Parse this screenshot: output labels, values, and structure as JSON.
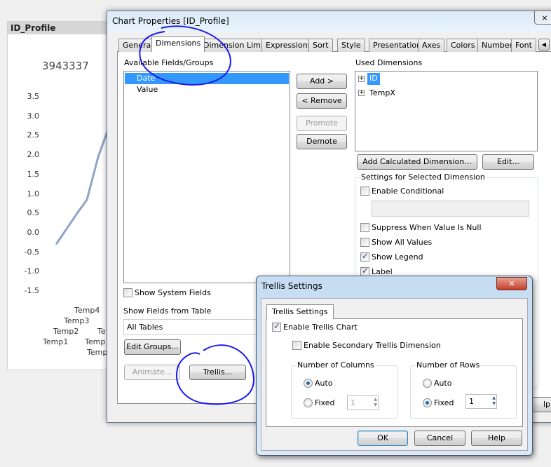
{
  "chart_panel": {
    "title": "ID_Profile",
    "value": "3943337",
    "chart_data": {
      "type": "line",
      "y_ticks": [
        "3.5",
        "3.0",
        "2.5",
        "2.0",
        "1.5",
        "1.0",
        "0.5",
        "0.0",
        "-0.5",
        "-1.0",
        "-1.5"
      ],
      "ylim": [
        -1.5,
        3.5
      ],
      "x_labels": [
        "Temp1",
        "Temp2",
        "Temp3",
        "Temp4",
        "Te",
        "Temp",
        "Temp"
      ],
      "series": [
        {
          "values": [
            -0.3,
            0.5,
            0.85,
            1.95,
            2.7
          ]
        }
      ],
      "line_color": "#8ea4c8"
    }
  },
  "dialog": {
    "title": "Chart Properties [ID_Profile]",
    "tabs": [
      "General",
      "Dimensions",
      "Dimension Limits",
      "Expressions",
      "Sort",
      "Style",
      "Presentation",
      "Axes",
      "Colors",
      "Number",
      "Font"
    ],
    "active_tab": "Dimensions",
    "available_label": "Available Fields/Groups",
    "available_fields": [
      "Date",
      "Value"
    ],
    "add": "Add >",
    "remove": "< Remove",
    "promote": "Promote",
    "demote": "Demote",
    "used_label": "Used Dimensions",
    "used_dimensions": [
      "ID",
      "TempX"
    ],
    "add_calc": "Add Calculated Dimension...",
    "edit": "Edit...",
    "settings_title": "Settings for Selected Dimension",
    "enable_conditional": "Enable Conditional",
    "suppress_null": "Suppress When Value Is Null",
    "show_all_values": "Show All Values",
    "show_legend": "Show Legend",
    "label": "Label",
    "show_system_fields": "Show System Fields",
    "show_fields_from_table": "Show Fields from Table",
    "table_value": "All Tables",
    "edit_groups": "Edit Groups...",
    "animate": "Animate...",
    "trellis": "Trellis...",
    "help_partial": "lp"
  },
  "trellis": {
    "title": "Trellis Settings",
    "tab": "Trellis Settings",
    "enable": "Enable Trellis Chart",
    "secondary": "Enable Secondary Trellis Dimension",
    "columns": {
      "title": "Number of Columns",
      "auto": "Auto",
      "fixed": "Fixed",
      "value": "1",
      "selected": "Auto"
    },
    "rows": {
      "title": "Number of Rows",
      "auto": "Auto",
      "fixed": "Fixed",
      "value": "1",
      "selected": "Fixed"
    },
    "ok": "OK",
    "cancel": "Cancel",
    "help": "Help"
  },
  "annotation_color": "#1a1aee"
}
